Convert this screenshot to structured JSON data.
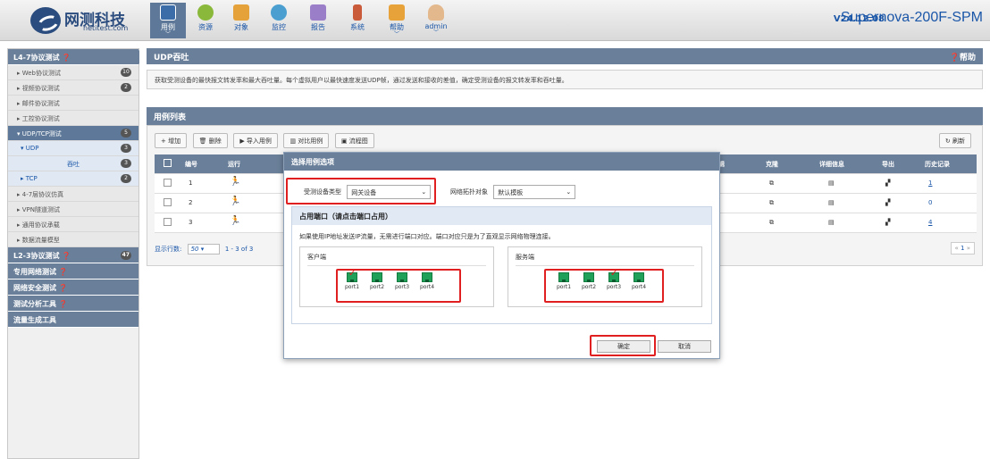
{
  "header": {
    "logo_cn": "网测科技",
    "logo_en": "netitest.com",
    "nav": [
      {
        "label": "用例",
        "icon": "test-case-icon",
        "active": true,
        "caret": true
      },
      {
        "label": "资源",
        "icon": "resource-icon",
        "active": false,
        "caret": false
      },
      {
        "label": "对象",
        "icon": "object-icon",
        "active": false,
        "caret": false
      },
      {
        "label": "监控",
        "icon": "monitor-icon",
        "active": false,
        "caret": false
      },
      {
        "label": "报告",
        "icon": "report-icon",
        "active": false,
        "caret": false
      },
      {
        "label": "系统",
        "icon": "system-icon",
        "active": false,
        "caret": false
      },
      {
        "label": "帮助",
        "icon": "help-icon",
        "active": false,
        "caret": true
      },
      {
        "label": "admin",
        "icon": "user-icon",
        "active": false,
        "caret": true
      }
    ],
    "version": "V24.12.08",
    "product": "Supernova-200F-SPM"
  },
  "sidebar": {
    "section1": {
      "label": "L4-7协议测试",
      "icon": "help-circle-icon"
    },
    "items": [
      {
        "label": "▸ Web协议测试",
        "badge": "10"
      },
      {
        "label": "▸ 视频协议测试",
        "badge": "2"
      },
      {
        "label": "▸ 邮件协议测试",
        "badge": ""
      },
      {
        "label": "▸ 工控协议测试",
        "badge": ""
      }
    ],
    "udp_tcp": {
      "label": "▾ UDP/TCP测试",
      "badge": "5"
    },
    "udp": {
      "label": "▾ UDP",
      "badge": "3"
    },
    "throughput": {
      "label": "吞吐",
      "badge": "3"
    },
    "tcp": {
      "label": "▸ TCP",
      "badge": "2"
    },
    "items2": [
      {
        "label": "▸ 4-7层协议仿真"
      },
      {
        "label": "▸ VPN隧道测试"
      },
      {
        "label": "▸ 通用协议承载"
      },
      {
        "label": "▸ 数据流量模型"
      }
    ],
    "sections": [
      {
        "label": "L2-3协议测试",
        "badge": "47"
      },
      {
        "label": "专用网络测试",
        "badge": ""
      },
      {
        "label": "网络安全测试",
        "badge": ""
      },
      {
        "label": "测试分析工具",
        "badge": ""
      },
      {
        "label": "流量生成工具",
        "badge": ""
      }
    ]
  },
  "main": {
    "title": "UDP吞吐",
    "help": "❓帮助",
    "description": "获取受测设备的最快报文转发率和最大吞吐量。每个虚拟用户以最快速度发送UDP帧，通过发送和接收的差值，确定受测设备的报文转发率和吞吐量。",
    "list_title": "用例列表",
    "toolbar": {
      "add": "+ 增加",
      "delete": "🗑 删除",
      "import": "导入用例",
      "compare": "对比用例",
      "flowchart": "流程图",
      "refresh": "↻ 刷新"
    },
    "columns": {
      "num": "编号",
      "run": "运行",
      "edit": "编辑",
      "clone": "克隆",
      "detail": "详细信息",
      "export": "导出",
      "history": "历史记录"
    },
    "rows": [
      {
        "num": "1",
        "history": "1"
      },
      {
        "num": "2",
        "history": "0"
      },
      {
        "num": "3",
        "history": "4"
      }
    ],
    "pager": {
      "label": "显示行数:",
      "size": "50",
      "range": "1 - 3 of 3",
      "page": "1"
    }
  },
  "modal": {
    "title": "选择用例选项",
    "device_type_label": "受测设备类型",
    "device_type_value": "网关设备",
    "topology_label": "网络拓扑对象",
    "topology_value": "默认模板",
    "port_title": "占用端口（请点击端口占用）",
    "port_desc": "如果使用IP地址发送IP流量，无需进行端口对应。端口对应只是为了直观显示网络物理连接。",
    "client_label": "客户端",
    "server_label": "服务端",
    "client_ports": [
      {
        "label": "port1",
        "checked": true
      },
      {
        "label": "port2",
        "checked": false
      },
      {
        "label": "port3",
        "checked": false
      },
      {
        "label": "port4",
        "checked": false
      }
    ],
    "server_ports": [
      {
        "label": "port1",
        "checked": false
      },
      {
        "label": "port2",
        "checked": false
      },
      {
        "label": "port3",
        "checked": true
      },
      {
        "label": "port4",
        "checked": false
      }
    ],
    "ok": "确定",
    "cancel": "取消"
  },
  "colors": {
    "header_blue": "#6a7f99",
    "link_blue": "#1a56a8",
    "highlight_red": "#e02020",
    "port_green": "#21a05a"
  }
}
